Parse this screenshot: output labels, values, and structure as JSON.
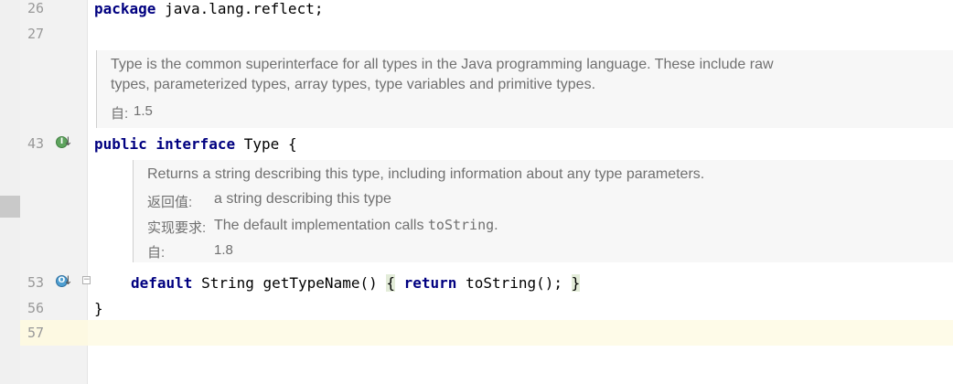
{
  "gutter": {
    "line_numbers": [
      "26",
      "27",
      "43",
      "53",
      "56",
      "57"
    ]
  },
  "code": {
    "line26": {
      "keyword": "package",
      "rest": " java.lang.reflect;"
    },
    "line43": {
      "kw1": "public",
      "kw2": "interface",
      "name": " Type ",
      "brace": "{"
    },
    "line53": {
      "kw_default": "default",
      "sig": " String getTypeName() ",
      "brace_open": "{",
      "kw_return": "return",
      "body": " toString(); ",
      "brace_close": "}"
    },
    "line56": {
      "brace": "}"
    }
  },
  "doc_type": {
    "line1": "Type is the common superinterface for all types in the Java programming language. These include raw",
    "line2": "types, parameterized types, array types, type variables and primitive types.",
    "since_label": "自:",
    "since_value": "1.5"
  },
  "doc_method": {
    "summary": "Returns a string describing this type, including information about any type parameters.",
    "returns_label": "返回值:",
    "returns_value": "a string describing this type",
    "impl_label": "实现要求:",
    "impl_value_prefix": "The default implementation calls ",
    "impl_value_code": "toString",
    "impl_value_suffix": ".",
    "since_label": "自:",
    "since_value": "1.8"
  },
  "markers": {
    "implemented_icon_letter": "I",
    "overrides_icon_letter": "O",
    "arrow": "↓",
    "fold": "−"
  },
  "colors": {
    "keyword": "#000080",
    "doc_text": "#707070",
    "current_line": "#fefbe8",
    "brace_match": "#e3ecd9"
  }
}
